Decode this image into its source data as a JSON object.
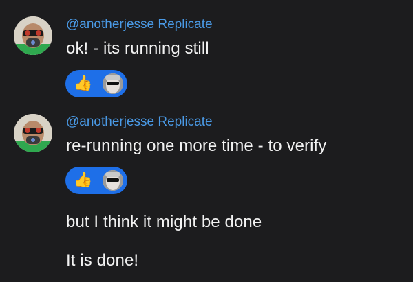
{
  "messages": [
    {
      "author": "@anotherjesse Replicate",
      "text": "ok! - its running still",
      "reaction_emoji": "👍"
    },
    {
      "author": "@anotherjesse Replicate",
      "text": "re-running one more time - to verify",
      "reaction_emoji": "👍"
    }
  ],
  "followups": [
    {
      "text": "but I think it might be done"
    },
    {
      "text": "It is done!"
    }
  ],
  "colors": {
    "background": "#1c1c1e",
    "author": "#4a9ae6",
    "reaction_pill": "#1e6fe8",
    "text": "#f2f2f2"
  }
}
